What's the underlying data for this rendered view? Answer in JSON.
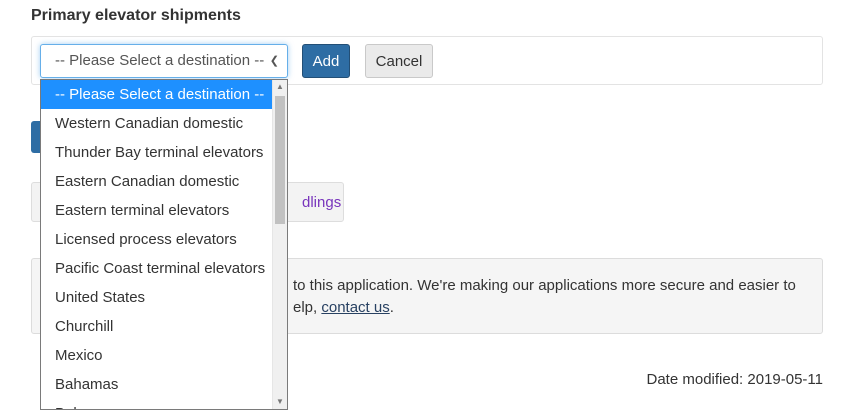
{
  "page": {
    "title": "Primary elevator shipments",
    "date_modified": "Date modified: 2019-05-11"
  },
  "form": {
    "select_value": "-- Please Select a destination --",
    "add_label": "Add",
    "cancel_label": "Cancel"
  },
  "dropdown": {
    "options": [
      "-- Please Select a destination --",
      "Western Canadian domestic",
      "Thunder Bay terminal elevators",
      "Eastern Canadian domestic",
      "Eastern terminal elevators",
      "Licensed process elevators",
      "Pacific Coast terminal elevators",
      "United States",
      "Churchill",
      "Mexico",
      "Bahamas",
      "Bel"
    ],
    "selected_index": 0,
    "scroll_thumb_fraction": 0.43
  },
  "partial": {
    "tab_text": "dlings",
    "notice_line1": "to this application. We're making our applications more secure and easier to",
    "notice_line2_pre": "elp, ",
    "notice_link": "contact us",
    "notice_line2_post": "."
  },
  "colors": {
    "primary_button": "#2e6da4",
    "selected_option": "#1e90ff",
    "link_visited": "#7834bc"
  },
  "icons": {
    "select_arrow": "chevron-down-icon",
    "scroll_up": "triangle-up-icon",
    "scroll_down": "triangle-down-icon"
  }
}
